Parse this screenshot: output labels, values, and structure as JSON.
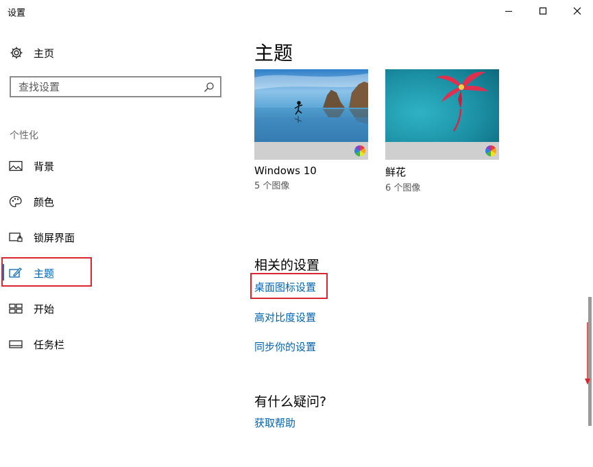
{
  "window": {
    "title": "设置",
    "minimize_label": "minimize",
    "maximize_label": "maximize",
    "close_label": "close"
  },
  "sidebar": {
    "home_label": "主页",
    "search_placeholder": "查找设置",
    "section_label": "个性化",
    "items": [
      {
        "label": "背景",
        "icon": "picture-icon"
      },
      {
        "label": "颜色",
        "icon": "palette-icon"
      },
      {
        "label": "锁屏界面",
        "icon": "lock-screen-icon"
      },
      {
        "label": "主题",
        "icon": "theme-brush-icon",
        "active": true
      },
      {
        "label": "开始",
        "icon": "start-tiles-icon"
      },
      {
        "label": "任务栏",
        "icon": "taskbar-icon"
      }
    ]
  },
  "main": {
    "title": "主题",
    "themes": [
      {
        "name": "Windows 10",
        "count": "5 个图像"
      },
      {
        "name": "鲜花",
        "count": "6 个图像"
      }
    ],
    "related": {
      "heading": "相关的设置",
      "links": [
        "桌面图标设置",
        "高对比度设置",
        "同步你的设置"
      ]
    },
    "help": {
      "heading": "有什么疑问?",
      "link": "获取帮助"
    }
  },
  "colors": {
    "accent": "#0063b1",
    "active_bar": "#0078d7",
    "annotation_red": "#d9262e"
  }
}
